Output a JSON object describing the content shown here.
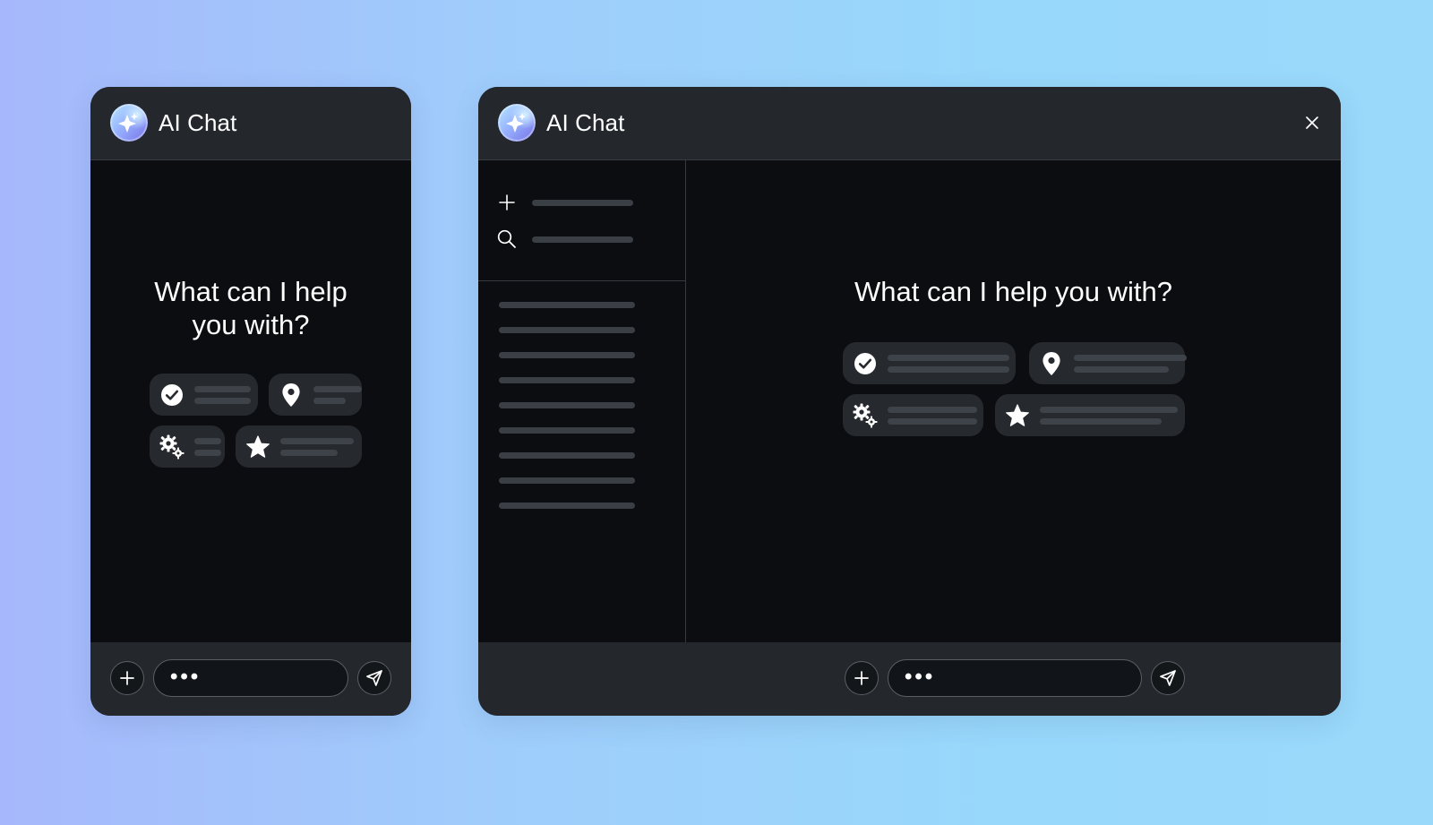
{
  "small_window": {
    "title": "AI Chat",
    "prompt": "What can I help you with?",
    "suggestions": [
      {
        "icon": "check-circle-icon"
      },
      {
        "icon": "map-pin-icon"
      },
      {
        "icon": "gears-icon"
      },
      {
        "icon": "star-icon"
      }
    ],
    "composer": {
      "input_placeholder": "•••"
    }
  },
  "large_window": {
    "title": "AI Chat",
    "prompt": "What can I help you with?",
    "sidebar": {
      "actions": [
        {
          "icon": "plus-icon"
        },
        {
          "icon": "search-icon"
        }
      ],
      "history_items_count": 9
    },
    "suggestions": [
      {
        "icon": "check-circle-icon"
      },
      {
        "icon": "map-pin-icon"
      },
      {
        "icon": "gears-icon"
      },
      {
        "icon": "star-icon"
      }
    ],
    "composer": {
      "input_placeholder": "•••"
    }
  },
  "colors": {
    "background_left": "#a6b8fb",
    "background_right": "#9ad9fa",
    "window_body": "#0b0d10",
    "window_header": "#24282d",
    "chip_background": "#262a2f",
    "placeholder_line": "#3e4349",
    "text_primary": "#ffffff"
  }
}
